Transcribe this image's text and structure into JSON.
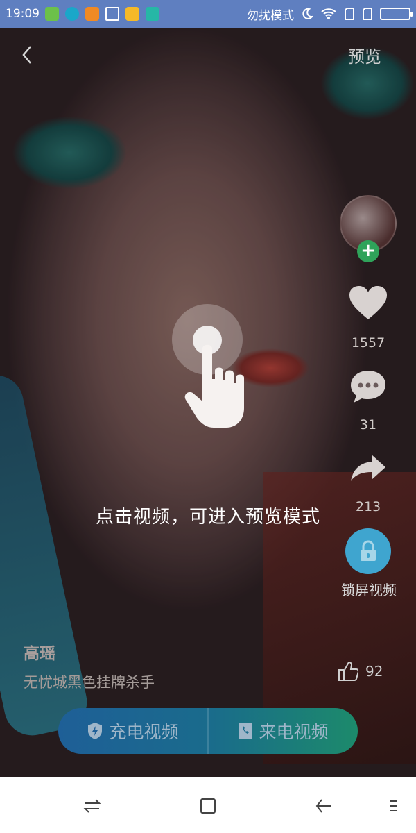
{
  "status_bar": {
    "time": "19:09",
    "dnd_label": "勿扰模式",
    "colors": {
      "bg": "#5f7fc0"
    }
  },
  "top_bar": {
    "back_icon": "chevron-left-icon",
    "preview_label": "预览"
  },
  "side": {
    "like_count": "1557",
    "comment_count": "31",
    "share_count": "213",
    "lock_label": "锁屏视频"
  },
  "hint": {
    "text": "点击视频，可进入预览模式"
  },
  "video_info": {
    "author": "高瑶",
    "description": "无忧城黑色挂牌杀手",
    "thumbs_count": "92"
  },
  "charge_bar": {
    "left_label": "充电视频",
    "right_label": "来电视频"
  },
  "colors": {
    "accent_blue": "#3fa5cf",
    "follow_green": "#2fa35a",
    "bar_left": "#1e5f97",
    "bar_right": "#1c8a6b"
  }
}
